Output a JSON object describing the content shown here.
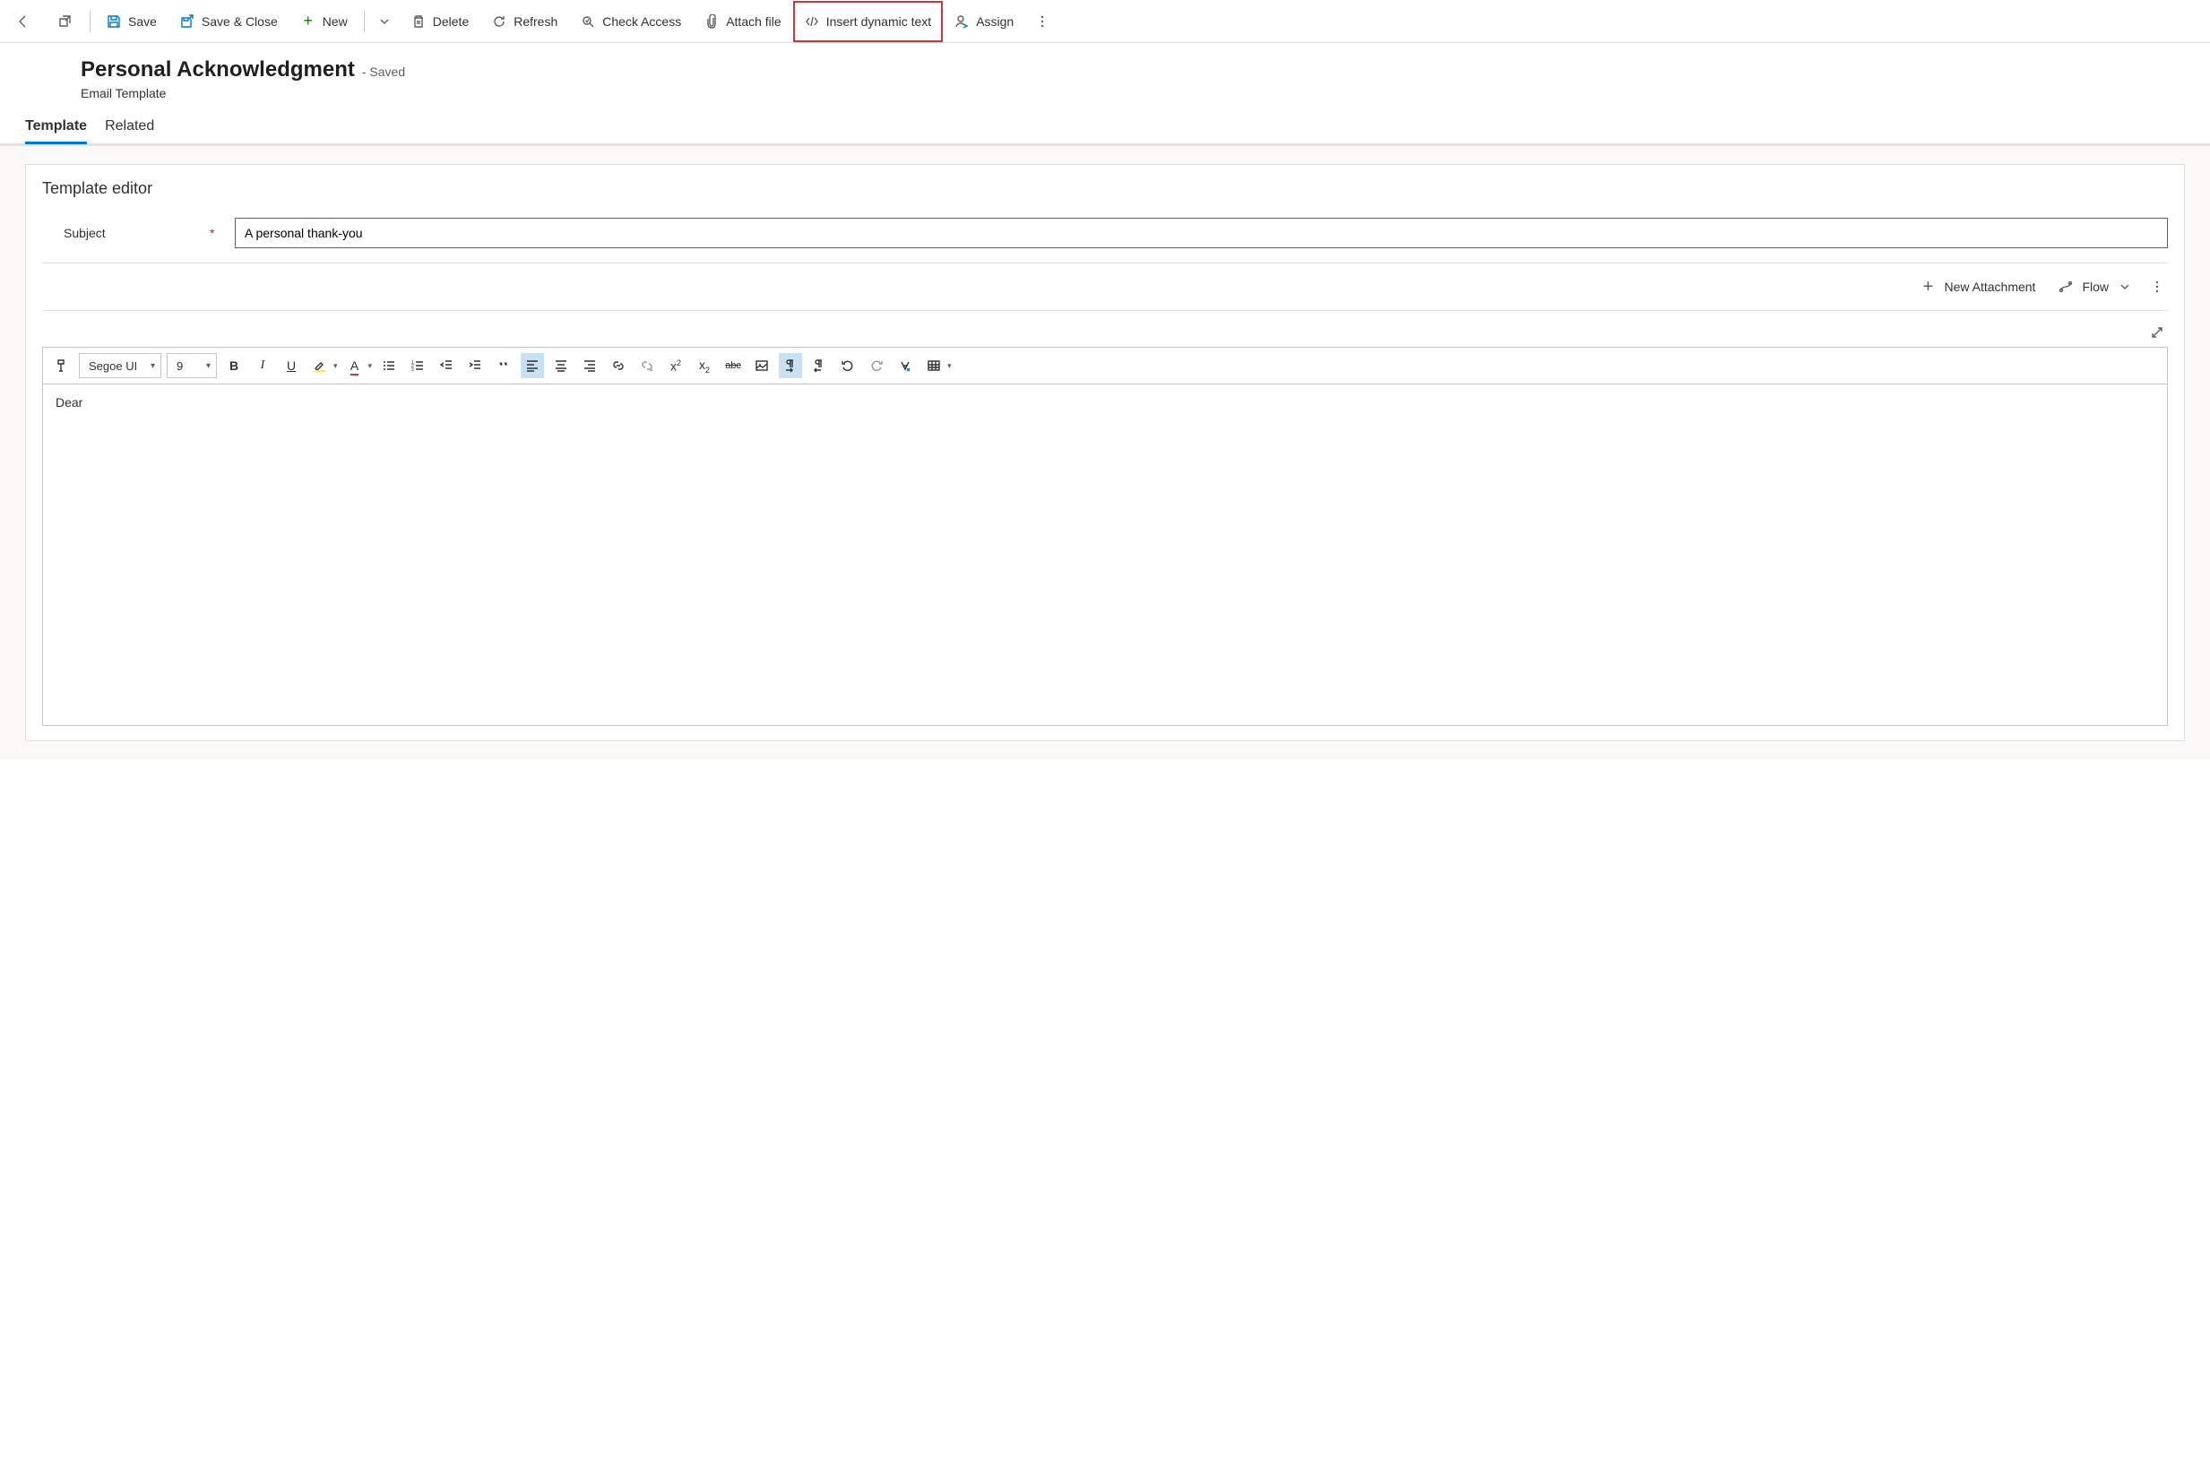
{
  "toolbar": {
    "save": "Save",
    "save_close": "Save & Close",
    "new": "New",
    "delete": "Delete",
    "refresh": "Refresh",
    "check_access": "Check Access",
    "attach_file": "Attach file",
    "insert_dynamic": "Insert dynamic text",
    "assign": "Assign"
  },
  "header": {
    "title": "Personal Acknowledgment",
    "status": "- Saved",
    "entity": "Email Template"
  },
  "tabs": {
    "template": "Template",
    "related": "Related"
  },
  "editor_section": {
    "title": "Template editor",
    "subject_label": "Subject",
    "subject_value": "A personal thank-you",
    "new_attachment": "New Attachment",
    "flow": "Flow"
  },
  "rte": {
    "font_family": "Segoe UI",
    "font_size": "9",
    "body": "Dear"
  }
}
